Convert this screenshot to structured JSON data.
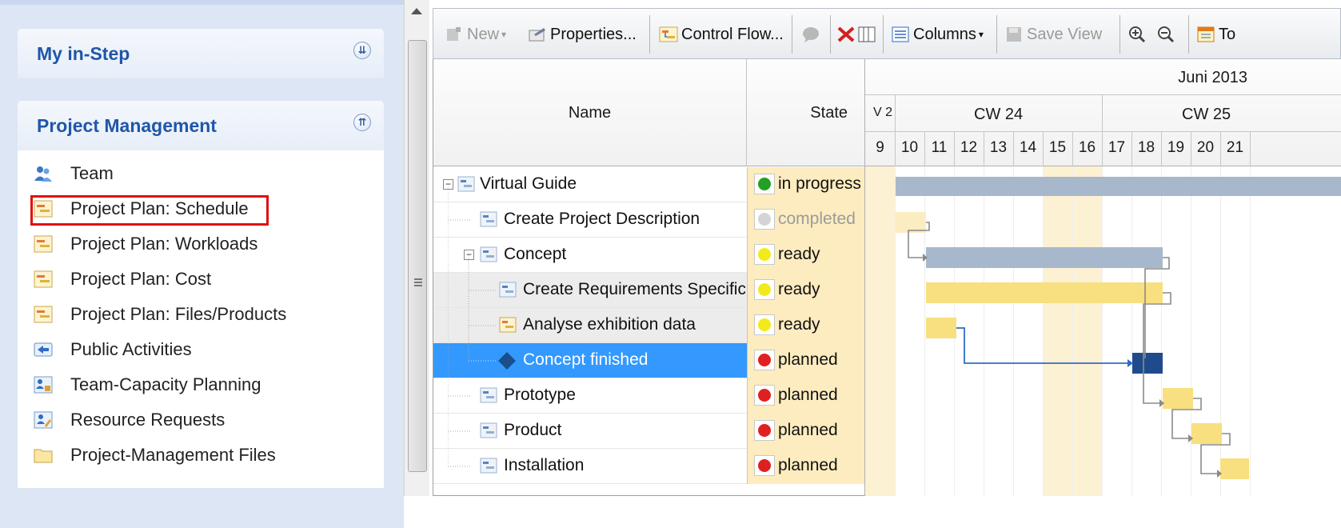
{
  "nav": {
    "sections": [
      {
        "title": "My in-Step",
        "toggle": "˅˅"
      },
      {
        "title": "Project Management",
        "toggle": "˄˄"
      }
    ],
    "items": [
      {
        "label": "Team",
        "icon": "team-icon"
      },
      {
        "label": "Project Plan: Schedule",
        "icon": "schedule-icon",
        "selected": true
      },
      {
        "label": "Project Plan: Workloads",
        "icon": "schedule-icon"
      },
      {
        "label": "Project Plan: Cost",
        "icon": "schedule-icon"
      },
      {
        "label": "Project Plan: Files/Products",
        "icon": "schedule-icon"
      },
      {
        "label": "Public Activities",
        "icon": "public-activities-icon"
      },
      {
        "label": "Team-Capacity Planning",
        "icon": "capacity-icon"
      },
      {
        "label": "Resource Requests",
        "icon": "resource-requests-icon"
      },
      {
        "label": "Project-Management Files",
        "icon": "folder-icon"
      }
    ]
  },
  "toolbar": {
    "new_label": "New",
    "properties_label": "Properties...",
    "control_flow_label": "Control Flow...",
    "columns_label": "Columns",
    "save_view_label": "Save View",
    "truncated_label": "To"
  },
  "grid": {
    "name_header": "Name",
    "state_header": "State",
    "rows": [
      {
        "name": "Virtual Guide",
        "state": "in progress",
        "state_color": "#22a022"
      },
      {
        "name": "Create Project Description",
        "state": "completed",
        "state_color": "#d0d0d0"
      },
      {
        "name": "Concept",
        "state": "ready",
        "state_color": "#f2ea1a"
      },
      {
        "name": "Create Requirements Specificat",
        "state": "ready",
        "state_color": "#f2ea1a"
      },
      {
        "name": "Analyse exhibition data",
        "state": "ready",
        "state_color": "#f2ea1a"
      },
      {
        "name": "Concept finished",
        "state": "planned",
        "state_color": "#e02020"
      },
      {
        "name": "Prototype",
        "state": "planned",
        "state_color": "#e02020"
      },
      {
        "name": "Product",
        "state": "planned",
        "state_color": "#e02020"
      },
      {
        "name": "Installation",
        "state": "planned",
        "state_color": "#e02020"
      }
    ]
  },
  "gantt": {
    "month": "Juni 2013",
    "week_prev": "V 2",
    "weeks": [
      "CW 24",
      "CW 25"
    ],
    "days": [
      "9",
      "10",
      "11",
      "12",
      "13",
      "14",
      "15",
      "16",
      "17",
      "18",
      "19",
      "20",
      "21"
    ]
  },
  "colors": {
    "selection": "#3399ff",
    "state_background": "#fdecbf",
    "summary_bar": "#a8b8cc",
    "task_bar": "#f8df80",
    "milestone": "#1f4b8c",
    "highlight_border": "#e01010"
  }
}
